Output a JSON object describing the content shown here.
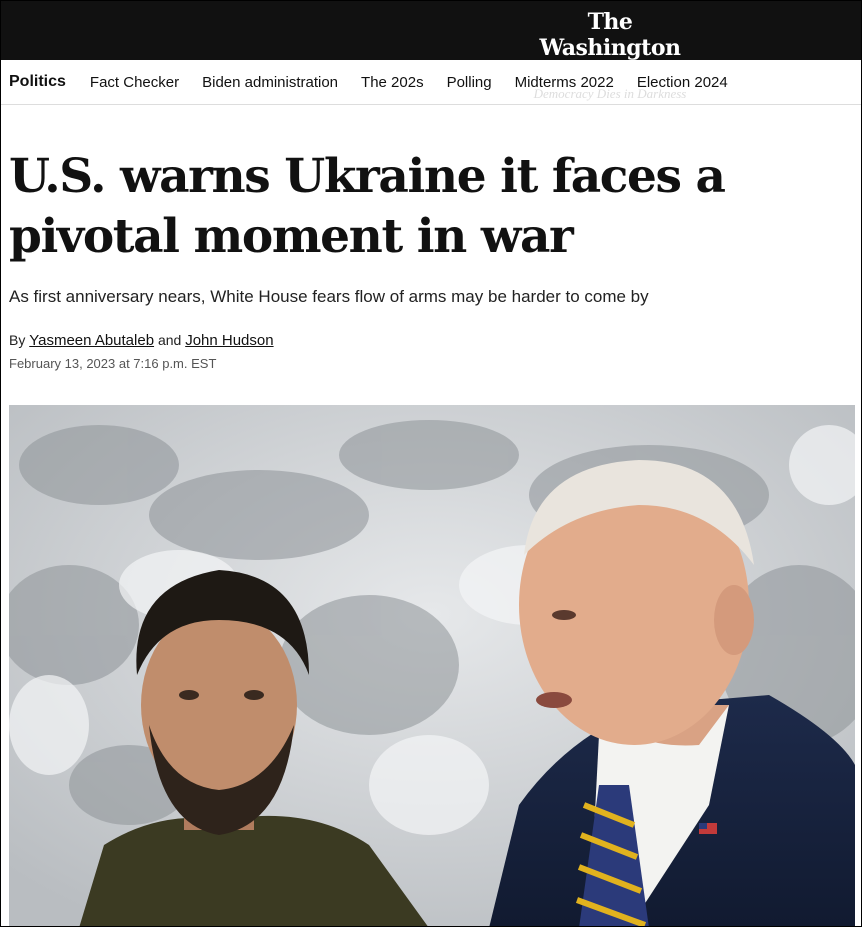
{
  "masthead": {
    "logo_name": "The Washington Post",
    "tagline": "Democracy Dies in Darkness"
  },
  "nav": {
    "section": "Politics",
    "items": [
      {
        "label": "Fact Checker"
      },
      {
        "label": "Biden administration"
      },
      {
        "label": "The 202s"
      },
      {
        "label": "Polling"
      },
      {
        "label": "Midterms 2022"
      },
      {
        "label": "Election 2024"
      }
    ]
  },
  "article": {
    "headline": "U.S. warns Ukraine it faces a pivotal moment in war",
    "dek": "As first anniversary nears, White House fears flow of arms may be harder to come by",
    "byline_prefix": "By",
    "author_1": "Yasmeen Abutaleb",
    "byline_and": "and",
    "author_2": "John Hudson",
    "date": "February 13, 2023 at 7:16 p.m. EST"
  },
  "colors": {
    "masthead_bg": "#111111",
    "text": "#111111",
    "muted": "#555555"
  }
}
